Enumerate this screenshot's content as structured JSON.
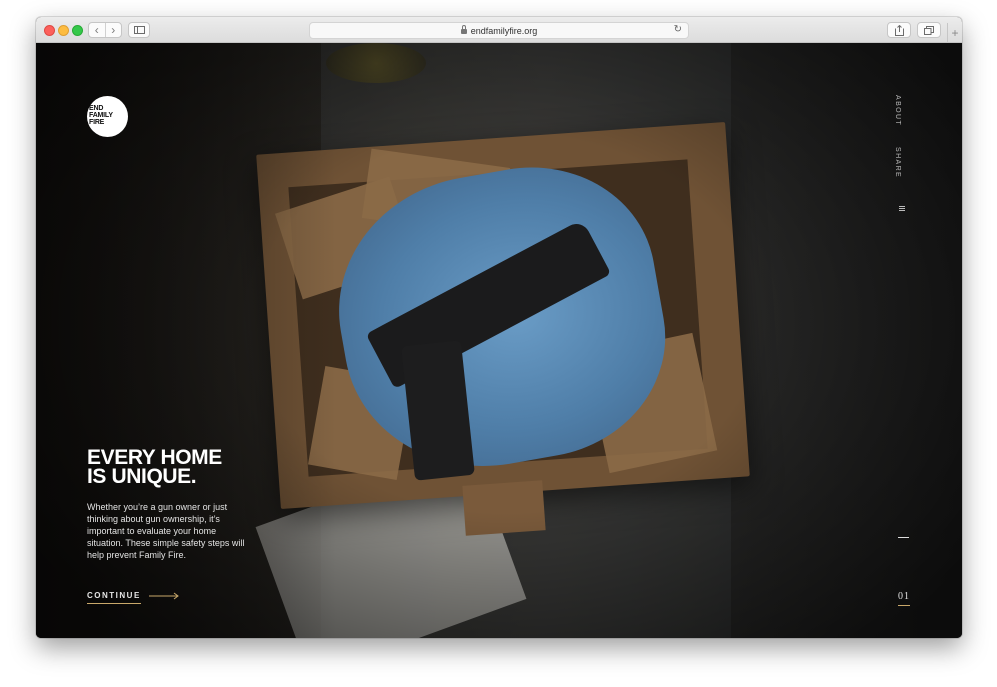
{
  "browser": {
    "url": "endfamilyfire.org"
  },
  "logo": {
    "line1": "END",
    "line2": "FAMILY",
    "line3": "FIRE"
  },
  "side_nav": {
    "about": "ABOUT",
    "share": "SHARE"
  },
  "hero": {
    "headline_line1": "EVERY HOME",
    "headline_line2": "IS UNIQUE.",
    "body": "Whether you’re a gun owner or just thinking about gun ownership, it’s important to evaluate your home situation. These simple safety steps will help prevent Family Fire.",
    "continue_label": "CONTINUE"
  },
  "pager": {
    "current": "01"
  },
  "colors": {
    "accent_underline": "#c9a86a",
    "text": "#ffffff"
  }
}
